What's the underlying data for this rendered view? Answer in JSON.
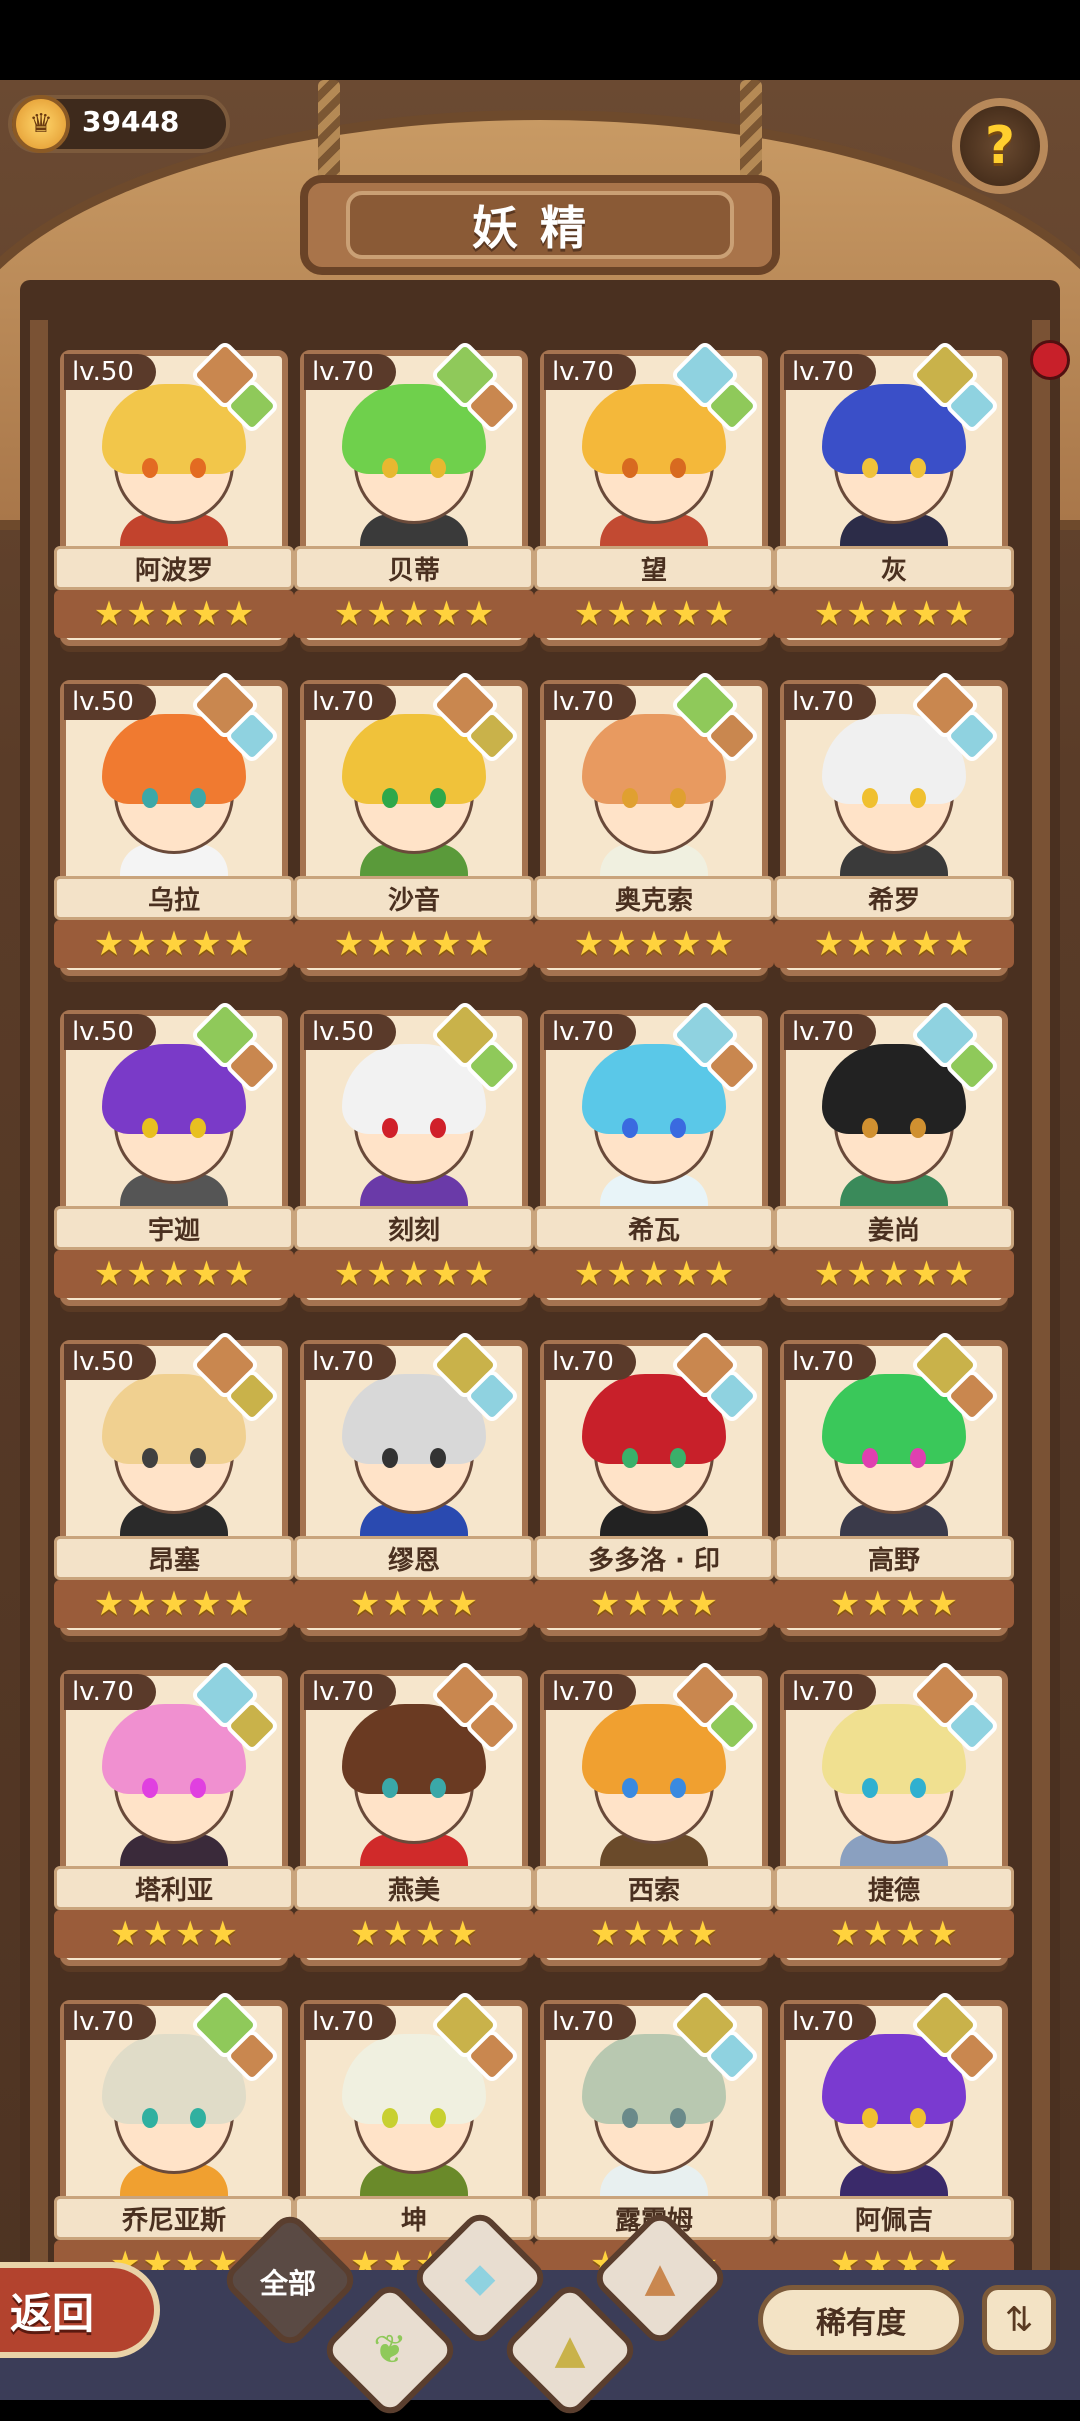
{
  "header": {
    "title": "妖精",
    "currency_value": "39448",
    "currency_icon": "coin-icon",
    "help_icon": "question-icon"
  },
  "colors": {
    "fire": "#c9874f",
    "earth": "#c9b24a",
    "nature": "#8fc95a",
    "water": "#8fd2e0"
  },
  "cards": [
    {
      "level": "lv.50",
      "name": "阿波罗",
      "stars": 5,
      "hair": "#f2c64a",
      "eye": "#e36b22",
      "body": "#c2432d",
      "elem1": "fire",
      "elem2": "nature"
    },
    {
      "level": "lv.70",
      "name": "贝蒂",
      "stars": 5,
      "hair": "#6fd04c",
      "eye": "#e8b830",
      "body": "#3a3a3a",
      "elem1": "nature",
      "elem2": "fire"
    },
    {
      "level": "lv.70",
      "name": "望",
      "stars": 5,
      "hair": "#f4b83a",
      "eye": "#d86a20",
      "body": "#c24a32",
      "elem1": "water",
      "elem2": "nature"
    },
    {
      "level": "lv.70",
      "name": "灰",
      "stars": 5,
      "hair": "#3a4fc8",
      "eye": "#f0c23a",
      "body": "#2c2c48",
      "elem1": "earth",
      "elem2": "water"
    },
    {
      "level": "lv.50",
      "name": "乌拉",
      "stars": 5,
      "hair": "#f07a30",
      "eye": "#3ca8a8",
      "body": "#f4f4f4",
      "elem1": "fire",
      "elem2": "water"
    },
    {
      "level": "lv.70",
      "name": "沙音",
      "stars": 5,
      "hair": "#f0c23a",
      "eye": "#2ea84a",
      "body": "#5a9a3a",
      "elem1": "fire",
      "elem2": "earth"
    },
    {
      "level": "lv.70",
      "name": "奥克索",
      "stars": 5,
      "hair": "#e89a60",
      "eye": "#e0a030",
      "body": "#f0f0e0",
      "elem1": "nature",
      "elem2": "fire"
    },
    {
      "level": "lv.70",
      "name": "希罗",
      "stars": 5,
      "hair": "#f0f0f0",
      "eye": "#f0c030",
      "body": "#3a3a3a",
      "elem1": "fire",
      "elem2": "water"
    },
    {
      "level": "lv.50",
      "name": "宇迦",
      "stars": 5,
      "hair": "#7a3ac8",
      "eye": "#e8c020",
      "body": "#555",
      "elem1": "nature",
      "elem2": "fire"
    },
    {
      "level": "lv.50",
      "name": "刻刻",
      "stars": 5,
      "hair": "#f2f2f2",
      "eye": "#d0202a",
      "body": "#6a3aa8",
      "elem1": "earth",
      "elem2": "nature"
    },
    {
      "level": "lv.70",
      "name": "希瓦",
      "stars": 5,
      "hair": "#5ac8e8",
      "eye": "#3a6ae0",
      "body": "#e8f4f8",
      "elem1": "water",
      "elem2": "fire"
    },
    {
      "level": "lv.70",
      "name": "姜尚",
      "stars": 5,
      "hair": "#222222",
      "eye": "#d09030",
      "body": "#3a8a5a",
      "elem1": "water",
      "elem2": "nature"
    },
    {
      "level": "lv.50",
      "name": "昂塞",
      "stars": 5,
      "hair": "#f0d090",
      "eye": "#404040",
      "body": "#2a2a2a",
      "elem1": "fire",
      "elem2": "earth"
    },
    {
      "level": "lv.70",
      "name": "缪恩",
      "stars": 4,
      "hair": "#d8d8d8",
      "eye": "#333",
      "body": "#2a4ab0",
      "elem1": "earth",
      "elem2": "water"
    },
    {
      "level": "lv.70",
      "name": "多多洛 · 印",
      "stars": 4,
      "hair": "#c8202a",
      "eye": "#3ab06a",
      "body": "#222",
      "elem1": "fire",
      "elem2": "water"
    },
    {
      "level": "lv.70",
      "name": "高野",
      "stars": 4,
      "hair": "#3ac85a",
      "eye": "#e040b0",
      "body": "#3a3a4a",
      "elem1": "earth",
      "elem2": "fire"
    },
    {
      "level": "lv.70",
      "name": "塔利亚",
      "stars": 4,
      "hair": "#f090d0",
      "eye": "#e040e0",
      "body": "#3a2a3a",
      "elem1": "water",
      "elem2": "earth"
    },
    {
      "level": "lv.70",
      "name": "燕美",
      "stars": 4,
      "hair": "#6a3a22",
      "eye": "#3aa8a8",
      "body": "#d02a2a",
      "elem1": "fire",
      "elem2": "fire"
    },
    {
      "level": "lv.70",
      "name": "西索",
      "stars": 4,
      "hair": "#f0a030",
      "eye": "#3a8ae0",
      "body": "#6a4a2a",
      "elem1": "fire",
      "elem2": "nature"
    },
    {
      "level": "lv.70",
      "name": "捷德",
      "stars": 4,
      "hair": "#f0e090",
      "eye": "#30b0d0",
      "body": "#8aa0c0",
      "elem1": "fire",
      "elem2": "water"
    },
    {
      "level": "lv.70",
      "name": "乔尼亚斯",
      "stars": 4,
      "hair": "#e0dcc8",
      "eye": "#30b0a0",
      "body": "#f0a030",
      "elem1": "nature",
      "elem2": "fire"
    },
    {
      "level": "lv.70",
      "name": "坤",
      "stars": 4,
      "hair": "#f0f0e0",
      "eye": "#c8d030",
      "body": "#6a8a2a",
      "elem1": "earth",
      "elem2": "fire"
    },
    {
      "level": "lv.70",
      "name": "露露姆",
      "stars": 4,
      "hair": "#b8c8b0",
      "eye": "#6a8a8a",
      "body": "#e8f0f0",
      "elem1": "earth",
      "elem2": "water"
    },
    {
      "level": "lv.70",
      "name": "阿佩吉",
      "stars": 4,
      "hair": "#7a3ad0",
      "eye": "#f0c030",
      "body": "#3a2a6a",
      "elem1": "earth",
      "elem2": "fire"
    }
  ],
  "bottom": {
    "back_label": "返回",
    "filter_all_label": "全部",
    "rarity_label": "稀有度",
    "filters": [
      "全部",
      "nature",
      "water",
      "earth",
      "fire"
    ]
  }
}
